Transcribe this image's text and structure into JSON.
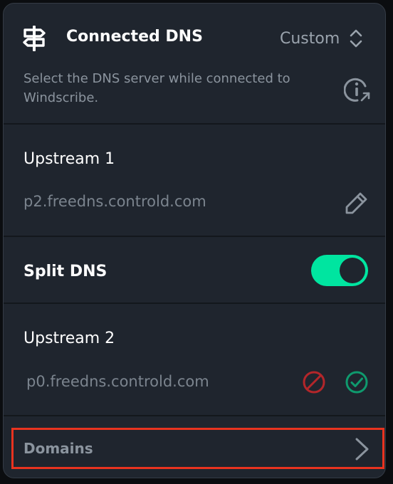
{
  "header": {
    "title": "Connected DNS",
    "mode_label": "Custom",
    "description": "Select the DNS server while connected to Windscribe.",
    "icons": {
      "main": "dns-signpost-icon",
      "mode_caret": "chevron-up-down-icon",
      "info": "info-link-icon"
    }
  },
  "upstream1": {
    "title": "Upstream 1",
    "value": "p2.freedns.controld.com",
    "edit_icon": "pencil-icon"
  },
  "split_dns": {
    "title": "Split DNS",
    "enabled": true,
    "accent_color": "#00e5a0"
  },
  "upstream2": {
    "title": "Upstream 2",
    "value": "p0.freedns.controld.com",
    "cancel_icon": "cancel-icon",
    "cancel_color": "#b3262a",
    "confirm_icon": "check-circle-icon",
    "confirm_color": "#0f9a6e"
  },
  "domains": {
    "label": "Domains",
    "highlight_color": "#e8331f",
    "icon": "chevron-right-icon"
  }
}
